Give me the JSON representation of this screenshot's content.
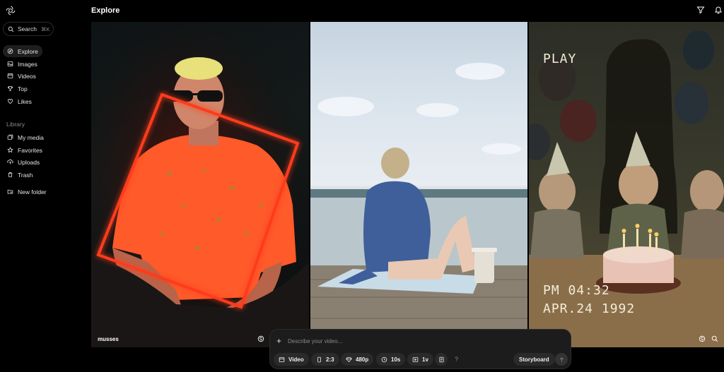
{
  "app": {
    "title": "Explore"
  },
  "search": {
    "label": "Search",
    "shortcut": "⌘K"
  },
  "nav": {
    "items": [
      {
        "label": "Explore",
        "icon": "compass-icon",
        "active": true
      },
      {
        "label": "Images",
        "icon": "image-icon"
      },
      {
        "label": "Videos",
        "icon": "video-icon"
      },
      {
        "label": "Top",
        "icon": "trophy-icon"
      },
      {
        "label": "Likes",
        "icon": "heart-icon"
      }
    ]
  },
  "library": {
    "label": "Library",
    "items": [
      {
        "label": "My media",
        "icon": "media-icon"
      },
      {
        "label": "Favorites",
        "icon": "star-icon"
      },
      {
        "label": "Uploads",
        "icon": "upload-icon"
      },
      {
        "label": "Trash",
        "icon": "trash-icon"
      },
      {
        "label": "New folder",
        "icon": "folder-plus-icon"
      }
    ]
  },
  "header": {
    "icons": [
      "filter-icon",
      "bell-icon"
    ]
  },
  "tiles": [
    {
      "caption": "musses",
      "scene": "neon-portrait"
    },
    {
      "caption": "",
      "scene": "dock-lake"
    },
    {
      "caption": "",
      "scene": "vhs-birthday",
      "overlay": {
        "play": "PLAY",
        "time": "PM 04:32",
        "date": "APR.24 1992"
      }
    }
  ],
  "composer": {
    "placeholder": "Describe your video...",
    "chips": {
      "type": "Video",
      "ratio": "2:3",
      "resolution": "480p",
      "duration": "10s",
      "variations": "1v"
    },
    "help": "?",
    "storyboard": "Storyboard"
  },
  "colors": {
    "accent_neon": "#ff3b1a",
    "background": "#000000",
    "composer_bg": "#1c1c1c"
  }
}
